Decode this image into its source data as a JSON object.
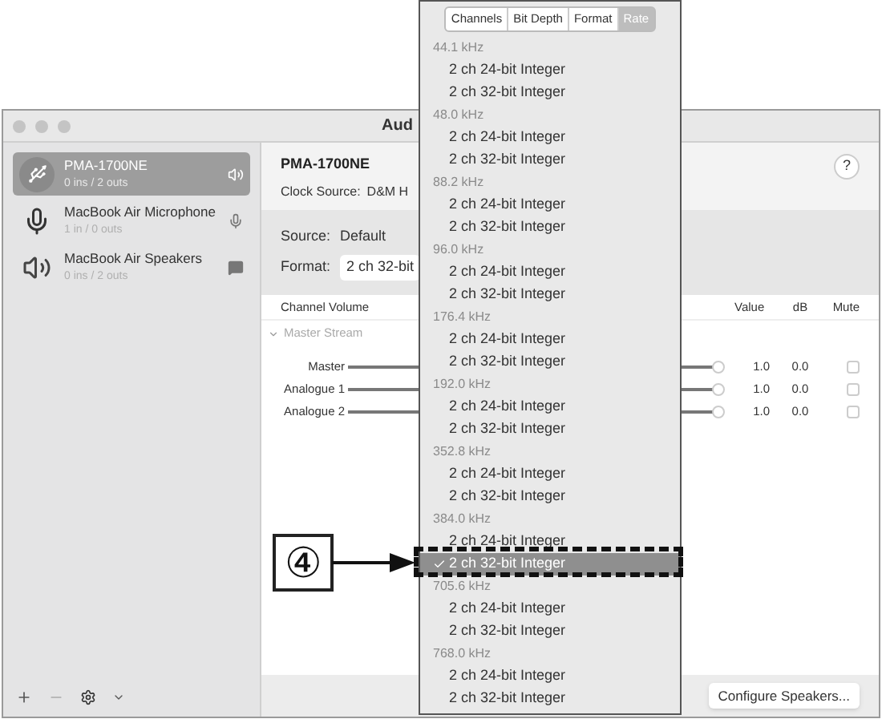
{
  "window": {
    "title": "Aud"
  },
  "sidebar": {
    "devices": [
      {
        "name": "PMA-1700NE",
        "io": "0 ins / 2 outs",
        "selected": true,
        "kind": "usb"
      },
      {
        "name": "MacBook Air Microphone",
        "io": "1 in / 0 outs",
        "selected": false,
        "kind": "mic"
      },
      {
        "name": "MacBook Air Speakers",
        "io": "0 ins / 2 outs",
        "selected": false,
        "kind": "speakers"
      }
    ]
  },
  "device": {
    "name": "PMA-1700NE",
    "clock_label": "Clock Source:",
    "clock_value": "D&M H",
    "help": "?"
  },
  "stream": {
    "source_label": "Source:",
    "source_value": "Default",
    "format_label": "Format:",
    "format_value": "2 ch 32-bit"
  },
  "table": {
    "columns": [
      "Channel Volume",
      "Value",
      "dB",
      "Mute"
    ],
    "group": {
      "label": "Master Stream",
      "expanded": true
    },
    "rows": [
      {
        "name": "Master",
        "level": 1,
        "value": "1.0",
        "db": "0.0",
        "muted": false
      },
      {
        "name": "Analogue 1",
        "level": 1,
        "value": "1.0",
        "db": "0.0",
        "muted": false
      },
      {
        "name": "Analogue 2",
        "level": 1,
        "value": "1.0",
        "db": "0.0",
        "muted": false
      }
    ]
  },
  "configure_button": "Configure Speakers...",
  "format_menu": {
    "tabs": [
      {
        "label": "Channels",
        "selected": false
      },
      {
        "label": "Bit Depth",
        "selected": false
      },
      {
        "label": "Format",
        "selected": false
      },
      {
        "label": "Rate",
        "selected": true
      }
    ],
    "groups": [
      {
        "rate": "44.1 kHz",
        "items": [
          {
            "label": "2 ch 24-bit Integer",
            "selected": false
          },
          {
            "label": "2 ch 32-bit Integer",
            "selected": false
          }
        ]
      },
      {
        "rate": "48.0 kHz",
        "items": [
          {
            "label": "2 ch 24-bit Integer",
            "selected": false
          },
          {
            "label": "2 ch 32-bit Integer",
            "selected": false
          }
        ]
      },
      {
        "rate": "88.2 kHz",
        "items": [
          {
            "label": "2 ch 24-bit Integer",
            "selected": false
          },
          {
            "label": "2 ch 32-bit Integer",
            "selected": false
          }
        ]
      },
      {
        "rate": "96.0 kHz",
        "items": [
          {
            "label": "2 ch 24-bit Integer",
            "selected": false
          },
          {
            "label": "2 ch 32-bit Integer",
            "selected": false
          }
        ]
      },
      {
        "rate": "176.4 kHz",
        "items": [
          {
            "label": "2 ch 24-bit Integer",
            "selected": false
          },
          {
            "label": "2 ch 32-bit Integer",
            "selected": false
          }
        ]
      },
      {
        "rate": "192.0 kHz",
        "items": [
          {
            "label": "2 ch 24-bit Integer",
            "selected": false
          },
          {
            "label": "2 ch 32-bit Integer",
            "selected": false
          }
        ]
      },
      {
        "rate": "352.8 kHz",
        "items": [
          {
            "label": "2 ch 24-bit Integer",
            "selected": false
          },
          {
            "label": "2 ch 32-bit Integer",
            "selected": false
          }
        ]
      },
      {
        "rate": "384.0 kHz",
        "items": [
          {
            "label": "2 ch 24-bit Integer",
            "selected": false
          },
          {
            "label": "2 ch 32-bit Integer",
            "selected": true
          }
        ]
      },
      {
        "rate": "705.6 kHz",
        "items": [
          {
            "label": "2 ch 24-bit Integer",
            "selected": false
          },
          {
            "label": "2 ch 32-bit Integer",
            "selected": false
          }
        ]
      },
      {
        "rate": "768.0 kHz",
        "items": [
          {
            "label": "2 ch 24-bit Integer",
            "selected": false
          },
          {
            "label": "2 ch 32-bit Integer",
            "selected": false
          }
        ]
      }
    ]
  },
  "callout": {
    "label": "④"
  }
}
